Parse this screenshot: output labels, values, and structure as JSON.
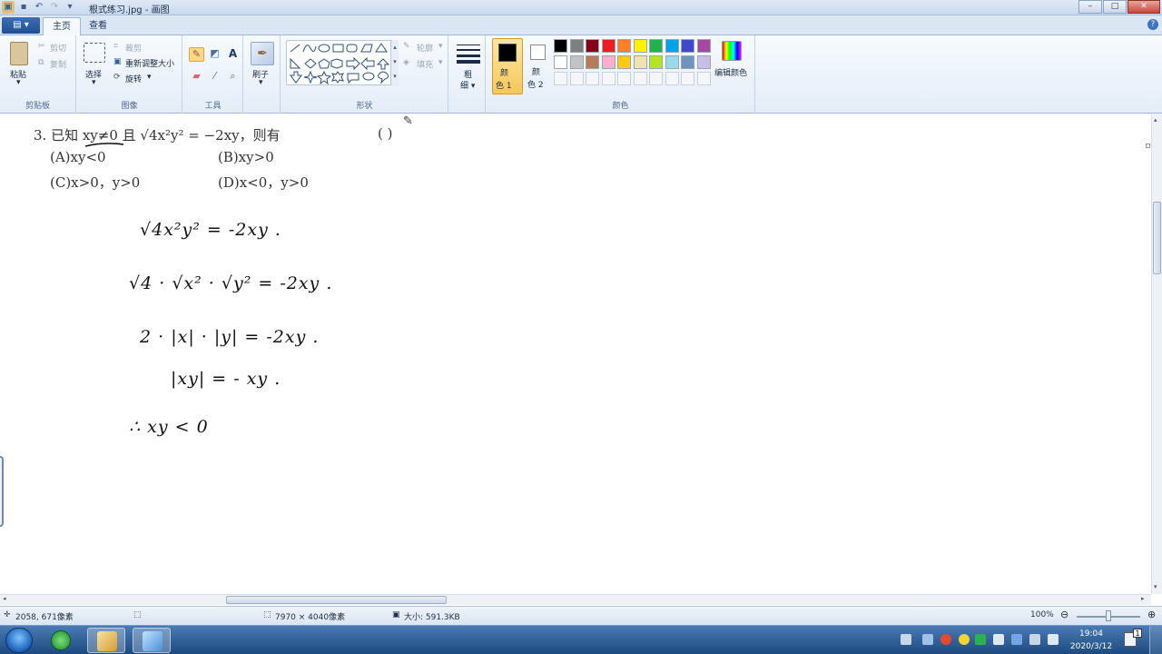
{
  "window": {
    "title": "根式练习.jpg - 画图",
    "controls": [
      "minimize",
      "maximize",
      "close"
    ]
  },
  "tabs": [
    {
      "label": "主页",
      "active": true
    },
    {
      "label": "查看",
      "active": false
    }
  ],
  "ribbon": {
    "clipboard": {
      "label": "剪贴板",
      "paste": "粘贴",
      "cut": "剪切",
      "copy": "复制"
    },
    "image": {
      "label": "图像",
      "select": "选择",
      "crop": "裁剪",
      "resize": "重新调整大小",
      "rotate": "旋转"
    },
    "tools": {
      "label": "工具"
    },
    "brushes": {
      "label": "刷子"
    },
    "shapes": {
      "label": "形状",
      "outline": "轮廓",
      "fill": "填充"
    },
    "size": {
      "label": "粗细"
    },
    "colors": {
      "label": "颜色",
      "color1": "颜色 1",
      "color2": "颜色 2",
      "edit": "编辑颜色",
      "color1_value": "#000000",
      "color2_value": "#ffffff",
      "palette_row1": [
        "#000000",
        "#7f7f7f",
        "#880015",
        "#ed1c24",
        "#ff7f27",
        "#fff200",
        "#22b14c",
        "#00a2e8",
        "#3f48cc",
        "#a349a4"
      ],
      "palette_row2": [
        "#ffffff",
        "#c3c3c3",
        "#b97a57",
        "#ffaec9",
        "#ffc90e",
        "#efe4b0",
        "#b5e61d",
        "#99d9ea",
        "#7092be",
        "#c8bfe7"
      ]
    }
  },
  "canvas": {
    "question": {
      "stem": "3. 已知 xy≠0 且 √4x²y² = −2xy，则有",
      "answer_paren": "(        )",
      "option_a": "(A)xy<0",
      "option_b": "(B)xy>0",
      "option_c": "(C)x>0，y>0",
      "option_d": "(D)x<0，y>0"
    },
    "handwriting": [
      "√4x²y² = -2xy .",
      "√4 · √x² · √y² = -2xy .",
      "2 · |x| · |y| = -2xy .",
      "|xy| = - xy .",
      "∴ xy < 0"
    ]
  },
  "statusbar": {
    "cursor_pos": "2058, 671像素",
    "image_size": "7970 × 4040像素",
    "file_size": "大小: 591.3KB",
    "zoom": "100%"
  },
  "taskbar": {
    "time": "19:04",
    "date": "2020/3/12",
    "notification_count": "1"
  }
}
